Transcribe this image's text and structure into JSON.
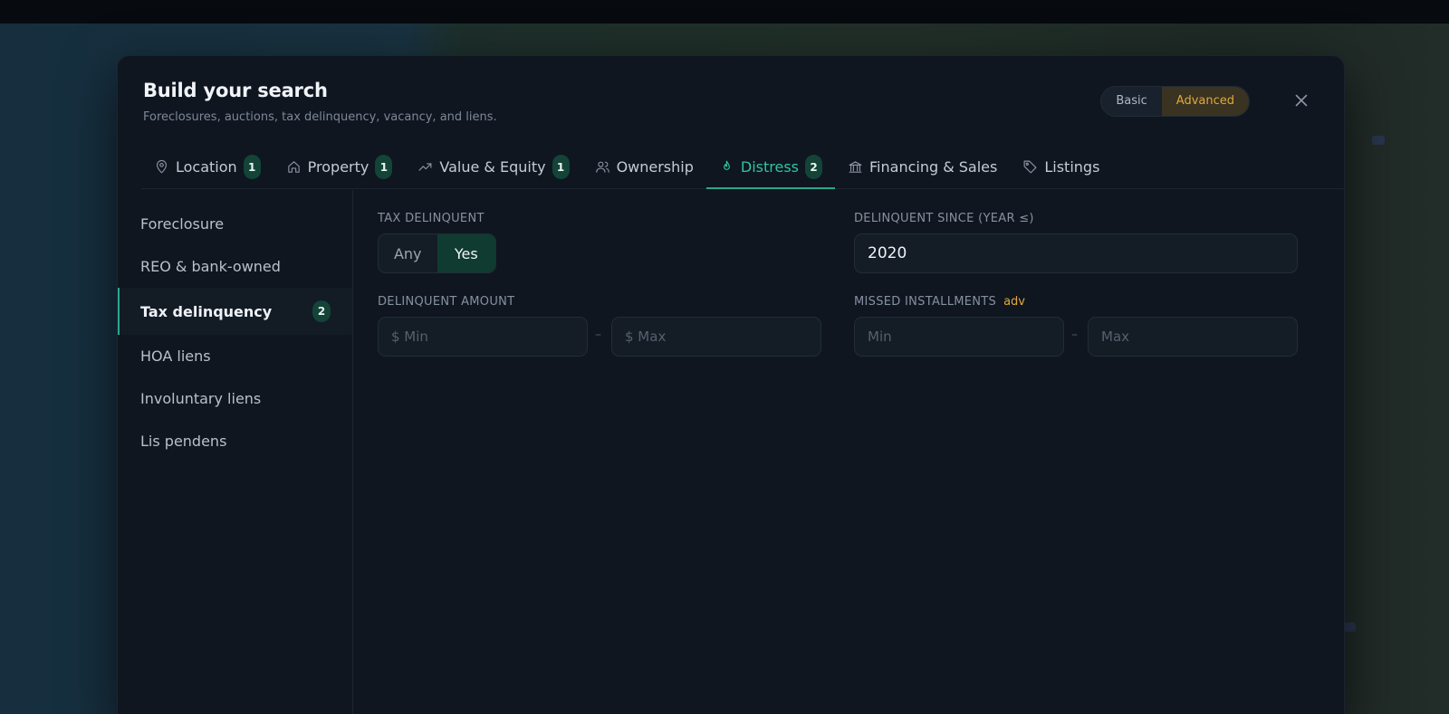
{
  "modal": {
    "title": "Build your search",
    "subtitle": "Foreclosures, auctions, tax delinquency, vacancy, and liens.",
    "mode_basic": "Basic",
    "mode_advanced": "Advanced",
    "active_mode": "Advanced"
  },
  "tabs": [
    {
      "label": "Location",
      "badge": "1",
      "icon": "map-pin-icon"
    },
    {
      "label": "Property",
      "badge": "1",
      "icon": "home-icon"
    },
    {
      "label": "Value & Equity",
      "badge": "1",
      "icon": "trending-up-icon"
    },
    {
      "label": "Ownership",
      "badge": "",
      "icon": "users-icon"
    },
    {
      "label": "Distress",
      "badge": "2",
      "icon": "flame-icon"
    },
    {
      "label": "Financing & Sales",
      "badge": "",
      "icon": "bank-icon"
    },
    {
      "label": "Listings",
      "badge": "",
      "icon": "tag-icon"
    }
  ],
  "active_tab": "Distress",
  "sidebar": {
    "items": [
      {
        "label": "Foreclosure",
        "badge": ""
      },
      {
        "label": "REO & bank-owned",
        "badge": ""
      },
      {
        "label": "Tax delinquency",
        "badge": "2"
      },
      {
        "label": "HOA liens",
        "badge": ""
      },
      {
        "label": "Involuntary liens",
        "badge": ""
      },
      {
        "label": "Lis pendens",
        "badge": ""
      }
    ],
    "active": "Tax delinquency"
  },
  "fields": {
    "tax_delinquent": {
      "label": "TAX DELINQUENT",
      "options": [
        "Any",
        "Yes"
      ],
      "selected": "Yes"
    },
    "delinquent_since": {
      "label": "DELINQUENT SINCE (YEAR ≤)",
      "value": "2020"
    },
    "delinquent_amount": {
      "label": "DELINQUENT AMOUNT",
      "min_placeholder": "$ Min",
      "max_placeholder": "$ Max",
      "separator": "–"
    },
    "missed_installments": {
      "label": "MISSED INSTALLMENTS",
      "tag": "adv",
      "min_placeholder": "Min",
      "max_placeholder": "Max",
      "separator": "–"
    }
  },
  "colors": {
    "accent": "#2fc4a3",
    "advanced": "#e1a93b",
    "badge_bg": "#134437"
  }
}
